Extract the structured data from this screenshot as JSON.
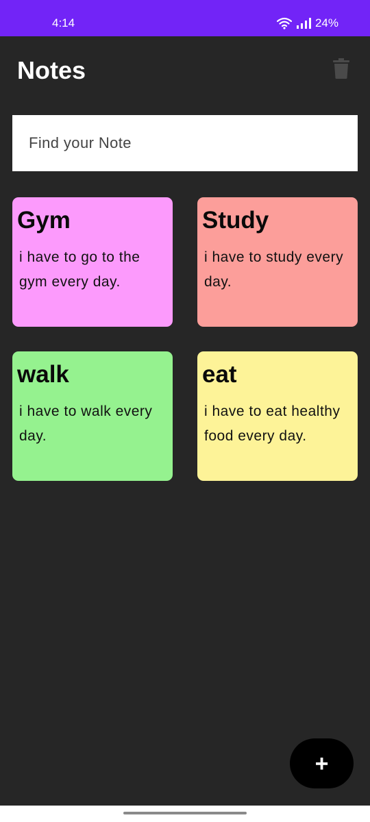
{
  "status_bar": {
    "time": "4:14",
    "battery": "24%",
    "wifi_icon": "wifi-icon",
    "signal_icon": "cell-signal-icon",
    "background_color": "#7224f7"
  },
  "header": {
    "title": "Notes",
    "trash_icon": "trash-icon"
  },
  "search": {
    "placeholder": "Find your Note",
    "value": ""
  },
  "notes": [
    {
      "title": "Gym",
      "body": "i have to go to the gym every day.",
      "color": "#fc9afc"
    },
    {
      "title": "Study",
      "body": "i have to study every day.",
      "color": "#fc9e9a"
    },
    {
      "title": "walk",
      "body": "i have to walk every day.",
      "color": "#95f28f"
    },
    {
      "title": "eat",
      "body": "i have to eat healthy food every day.",
      "color": "#fdf398"
    }
  ],
  "fab": {
    "label": "+",
    "icon": "add-icon"
  },
  "theme": {
    "background": "#262626",
    "fab_color": "#000000"
  }
}
